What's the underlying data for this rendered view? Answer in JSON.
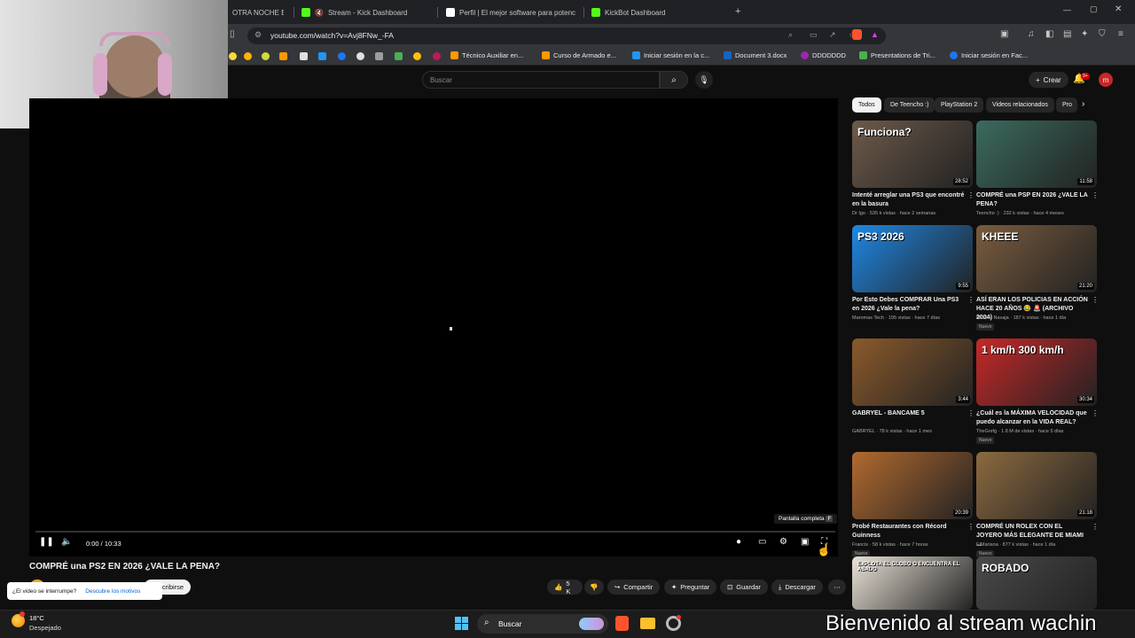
{
  "tabs": [
    {
      "label": "OTRA NOCHE EN",
      "color": "#d32f2f"
    },
    {
      "label": "Stream - Kick Dashboard",
      "color": "#53fc18"
    },
    {
      "label": "Perfil | El mejor software para potenc",
      "color": "#ffffff"
    },
    {
      "label": "KickBot Dashboard",
      "color": "#53fc18"
    }
  ],
  "new_tab": "+",
  "address": {
    "url": "youtube.com/watch?v=Avj8FNw_-FA"
  },
  "bookmarks": [
    {
      "label": "Técnico Auxiliar en...",
      "color": "#ff9800"
    },
    {
      "label": "Curso de Armado e...",
      "color": "#ff9800"
    },
    {
      "label": "Iniciar sesión en la c...",
      "color": "#2196f3"
    },
    {
      "label": "Document 3.docx",
      "color": "#1565c0"
    },
    {
      "label": "DDDDDDD",
      "color": "#9c27b0"
    },
    {
      "label": "Presentations de Tri...",
      "color": "#4caf50"
    },
    {
      "label": "Iniciar sesión en Fac...",
      "color": "#1877f2"
    }
  ],
  "youtube": {
    "search_placeholder": "Buscar",
    "create_label": "Crear",
    "notif_count": "9+",
    "avatar_letter": "m"
  },
  "player": {
    "fullscreen_tooltip": "Pantalla completa",
    "fullscreen_key": "F",
    "time": "0:00 / 10:33",
    "progress": 0
  },
  "video": {
    "title": "COMPRÉ una PS2 EN 2026 ¿VALE LA PENA?",
    "subscribe": "Suscribirse",
    "likes": "5 K",
    "share": "Compartir",
    "ask": "Preguntar",
    "save": "Guardar",
    "download": "Descargar"
  },
  "interrupt_prompt": {
    "question": "¿El video se interrumpe?",
    "link": "Descubre los motivos"
  },
  "chips": [
    "Todos",
    "De Teencho :)",
    "PlayStation 2",
    "Videos relacionados",
    "Pro"
  ],
  "recommendations": [
    {
      "title": "Intenté arreglar una PS3 que encontré en la basura",
      "meta": "Dr Igo · 535 k vistas · hace 2 semanas",
      "duration": "28:52",
      "thumb_text": "Funciona?",
      "thumb_color": "#6d5a4a",
      "nuevo": false
    },
    {
      "title": "COMPRÉ una PSP EN 2026 ¿VALE LA PENA?",
      "meta": "Teencho :) · 232 k vistas · hace 4 meses",
      "duration": "11:58",
      "thumb_text": "",
      "thumb_color": "#3a6b5e",
      "nuevo": false
    },
    {
      "title": "Por Esto Debes COMPRAR Una PS3 en 2026 ¿Vale la pena?",
      "meta": "Maromas Tech · 195 vistas · hace 7 días",
      "duration": "9:55",
      "thumb_text": "PS3 2026",
      "thumb_color": "#1e88e5",
      "nuevo": false
    },
    {
      "title": "ASÍ ERAN LOS POLICIAS EN ACCIÓN HACE 20 AÑOS 😂 🚨 (ARCHIVO 2004)",
      "meta": "Markito Navaja · 187 k vistas · hace 1 día",
      "duration": "21:20",
      "thumb_text": "KHEEE",
      "thumb_color": "#7a5c3e",
      "nuevo": true
    },
    {
      "title": "GABRYEL - BANCAME 5",
      "meta": "GABRYEL · 78 k vistas · hace 1 mes",
      "duration": "3:44",
      "thumb_text": "",
      "thumb_color": "#8a5a2b",
      "nuevo": false
    },
    {
      "title": "¿Cuál es la MÁXIMA VELOCIDAD que puedo alcanzar en la VIDA REAL?",
      "meta": "TheGrefg · 1.8 M de vistas · hace 5 días",
      "duration": "30:34",
      "thumb_text": "1 km/h   300 km/h",
      "thumb_color": "#c62828",
      "nuevo": true
    },
    {
      "title": "Probé Restaurantes con Récord Guinness",
      "meta": "Francis · 58 k vistas · hace 7 horas",
      "duration": "20:39",
      "thumb_text": "",
      "thumb_color": "#b26a2f",
      "nuevo": true
    },
    {
      "title": "COMPRÉ UN ROLEX CON EL JOYERO MÁS ELEGANTE DE MIAMI ...",
      "meta": "ElMariana · 877 k vistas · hace 1 día",
      "duration": "21:18",
      "thumb_text": "",
      "thumb_color": "#8c6a3f",
      "nuevo": true
    },
    {
      "title": "",
      "meta": "",
      "duration": "",
      "thumb_text": "EXPLOTA EL GLOBO O ENCUENTRA EL ASADO",
      "thumb_color": "#e9e2d6",
      "nuevo": false
    },
    {
      "title": "",
      "meta": "",
      "duration": "",
      "thumb_text": "ROBADO",
      "thumb_color": "#4a4a4a",
      "nuevo": false
    }
  ],
  "taskbar": {
    "temp": "18°C",
    "weather": "Despejado",
    "search": "Buscar"
  },
  "overlay_banner": "Bienvenido al stream wachin"
}
